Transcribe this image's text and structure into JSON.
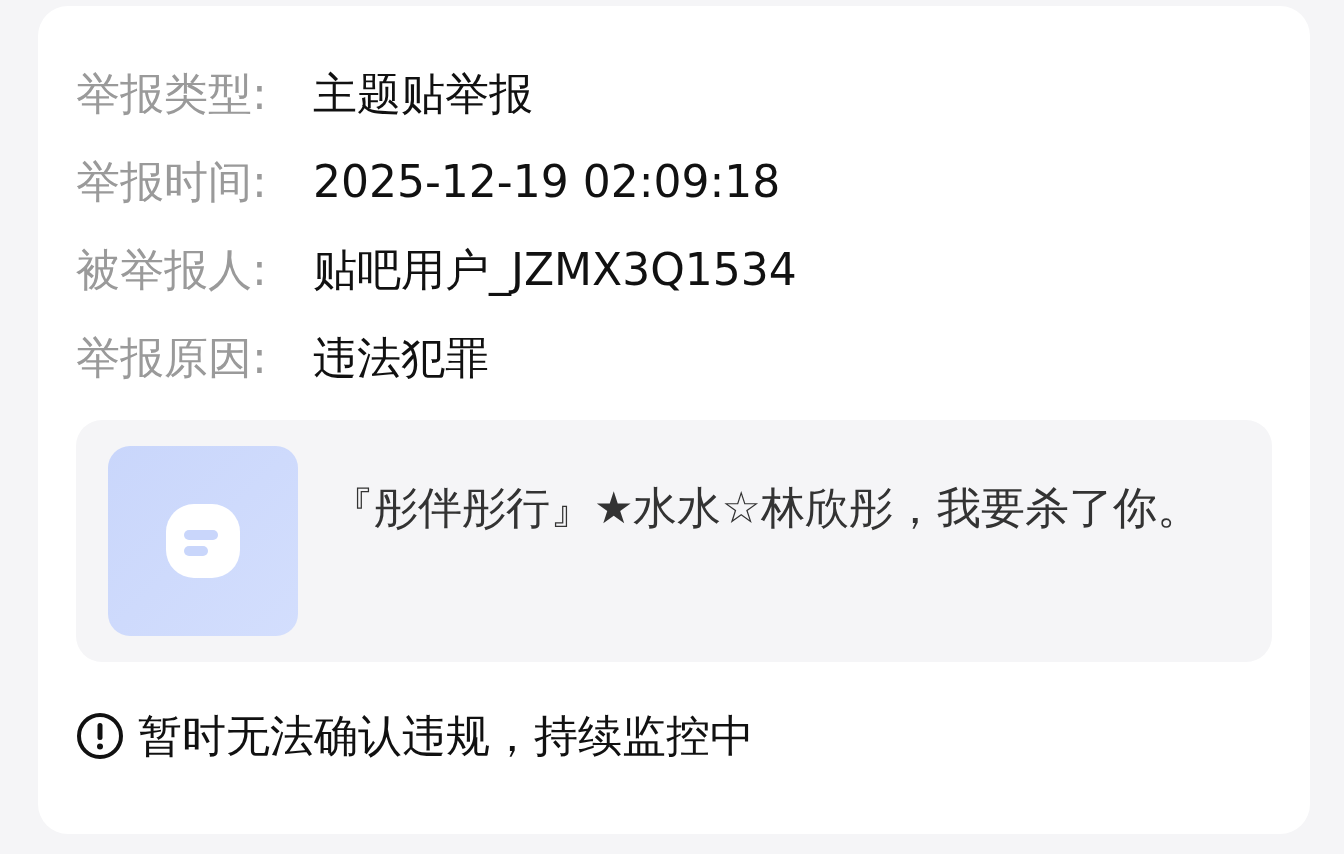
{
  "fields": [
    {
      "label": "举报类型:",
      "value": "主题贴举报"
    },
    {
      "label": "举报时间:",
      "value": "2025-12-19 02:09:18"
    },
    {
      "label": "被举报人:",
      "value": "贴吧用户_JZMX3Q1534"
    },
    {
      "label": "举报原因:",
      "value": "违法犯罪"
    }
  ],
  "reported_post": {
    "text": "『彤伴彤行』★水水☆林欣彤，我要杀了你。"
  },
  "status": {
    "text": "暂时无法确认违规，持续监控中"
  }
}
